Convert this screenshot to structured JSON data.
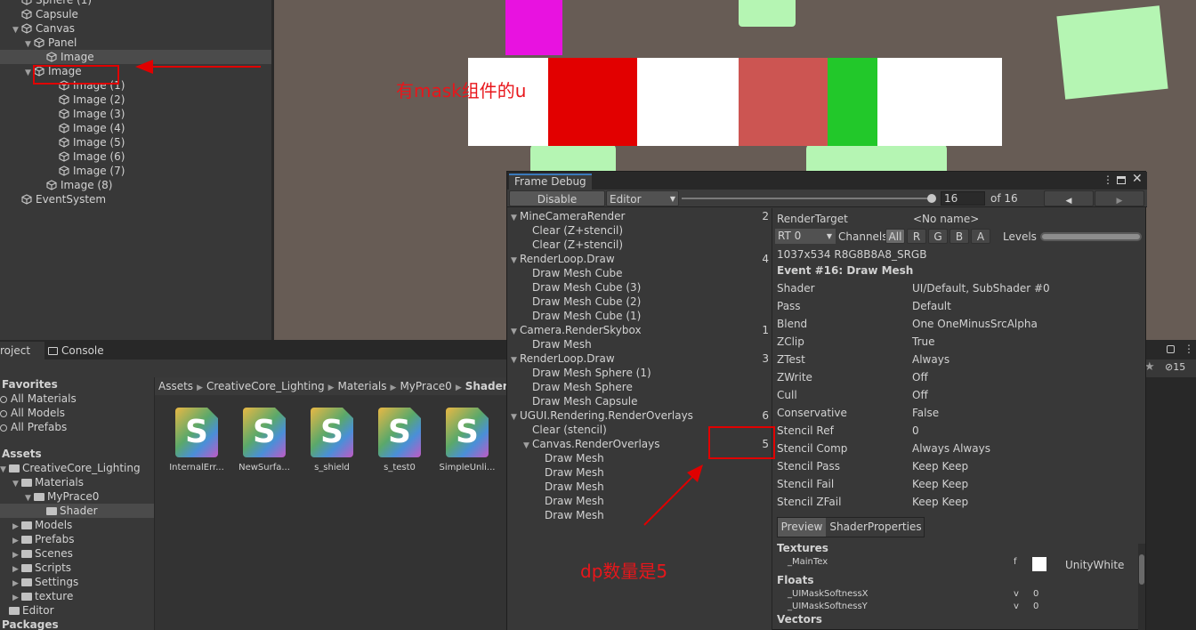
{
  "hierarchy": {
    "items": [
      {
        "label": "Sphere (1)",
        "indent": 1
      },
      {
        "label": "Capsule",
        "indent": 1
      },
      {
        "label": "Canvas",
        "indent": 1,
        "expanded": true
      },
      {
        "label": "Panel",
        "indent": 2,
        "expanded": true
      },
      {
        "label": "Image",
        "indent": 3,
        "selected": true
      },
      {
        "label": "Image",
        "indent": 2,
        "expanded": true,
        "highlighted": true
      },
      {
        "label": "Image (1)",
        "indent": 4
      },
      {
        "label": "Image (2)",
        "indent": 4
      },
      {
        "label": "Image (3)",
        "indent": 4
      },
      {
        "label": "Image (4)",
        "indent": 4
      },
      {
        "label": "Image (5)",
        "indent": 4
      },
      {
        "label": "Image (6)",
        "indent": 4
      },
      {
        "label": "Image (7)",
        "indent": 4
      },
      {
        "label": "Image (8)",
        "indent": 3
      },
      {
        "label": "EventSystem",
        "indent": 1
      }
    ]
  },
  "scene": {
    "annotation": "有mask组件的u"
  },
  "project": {
    "tab_project": "roject",
    "tab_console": "Console",
    "favorites_header": "Favorites",
    "favorites": [
      "All Materials",
      "All Models",
      "All Prefabs"
    ],
    "assets_header": "Assets",
    "tree": [
      {
        "label": "CreativeCore_Lighting",
        "indent": 0
      },
      {
        "label": "Materials",
        "indent": 1
      },
      {
        "label": "MyPrace0",
        "indent": 2
      },
      {
        "label": "Shader",
        "indent": 3,
        "selected": true
      },
      {
        "label": "Models",
        "indent": 1
      },
      {
        "label": "Prefabs",
        "indent": 1
      },
      {
        "label": "Scenes",
        "indent": 1
      },
      {
        "label": "Scripts",
        "indent": 1
      },
      {
        "label": "Settings",
        "indent": 1
      },
      {
        "label": "texture",
        "indent": 1
      },
      {
        "label": "Editor",
        "indent": 0
      }
    ],
    "packages_header": "Packages",
    "breadcrumb": [
      "Assets",
      "CreativeCore_Lighting",
      "Materials",
      "MyPrace0",
      "Shader"
    ],
    "assets": [
      "InternalErr...",
      "NewSurfa...",
      "s_shield",
      "s_test0",
      "SimpleUnli..."
    ],
    "asset_glyph": "S",
    "hidden_count": "15"
  },
  "frame_debug": {
    "title": "Frame Debug",
    "disable_label": "Disable",
    "editor_label": "Editor",
    "frame_value": "16",
    "of_label": "of 16",
    "events": [
      {
        "label": "MineCameraRender",
        "indent": 0,
        "count": "2"
      },
      {
        "label": "Clear (Z+stencil)",
        "indent": 1
      },
      {
        "label": "Clear (Z+stencil)",
        "indent": 1
      },
      {
        "label": "RenderLoop.Draw",
        "indent": 0,
        "count": "4"
      },
      {
        "label": "Draw Mesh Cube",
        "indent": 1
      },
      {
        "label": "Draw Mesh Cube (3)",
        "indent": 1
      },
      {
        "label": "Draw Mesh Cube (2)",
        "indent": 1
      },
      {
        "label": "Draw Mesh Cube (1)",
        "indent": 1
      },
      {
        "label": "Camera.RenderSkybox",
        "indent": 0,
        "count": "1"
      },
      {
        "label": "Draw Mesh",
        "indent": 1
      },
      {
        "label": "RenderLoop.Draw",
        "indent": 0,
        "count": "3"
      },
      {
        "label": "Draw Mesh Sphere (1)",
        "indent": 1
      },
      {
        "label": "Draw Mesh Sphere",
        "indent": 1
      },
      {
        "label": "Draw Mesh Capsule",
        "indent": 1
      },
      {
        "label": "UGUI.Rendering.RenderOverlays",
        "indent": 0,
        "count": "6"
      },
      {
        "label": "Clear (stencil)",
        "indent": 1
      },
      {
        "label": "Canvas.RenderOverlays",
        "indent": 1,
        "count": "5",
        "expanded": true
      },
      {
        "label": "Draw Mesh",
        "indent": 2
      },
      {
        "label": "Draw Mesh",
        "indent": 2
      },
      {
        "label": "Draw Mesh",
        "indent": 2
      },
      {
        "label": "Draw Mesh",
        "indent": 2
      },
      {
        "label": "Draw Mesh",
        "indent": 2
      }
    ],
    "render_target_label": "RenderTarget",
    "render_target_value": "<No name>",
    "rt_select": "RT 0",
    "channels_label": "Channels",
    "channels": [
      "All",
      "R",
      "G",
      "B",
      "A"
    ],
    "levels_label": "Levels",
    "format": "1037x534 R8G8B8A8_SRGB",
    "event_title": "Event #16: Draw Mesh",
    "props": [
      {
        "k": "Shader",
        "v": "UI/Default, SubShader #0"
      },
      {
        "k": "Pass",
        "v": "Default"
      },
      {
        "k": "Blend",
        "v": "One OneMinusSrcAlpha"
      },
      {
        "k": "ZClip",
        "v": "True"
      },
      {
        "k": "ZTest",
        "v": "Always"
      },
      {
        "k": "ZWrite",
        "v": "Off"
      },
      {
        "k": "Cull",
        "v": "Off"
      },
      {
        "k": "Conservative",
        "v": "False"
      },
      {
        "k": "Stencil Ref",
        "v": "0"
      },
      {
        "k": "Stencil Comp",
        "v": "Always Always"
      },
      {
        "k": "Stencil Pass",
        "v": "Keep Keep"
      },
      {
        "k": "Stencil Fail",
        "v": "Keep Keep"
      },
      {
        "k": "Stencil ZFail",
        "v": "Keep Keep"
      }
    ],
    "tab_preview": "Preview",
    "tab_shader_props": "ShaderProperties",
    "textures_header": "Textures",
    "main_tex": {
      "name": "_MainTex",
      "stage": "f",
      "value": "UnityWhite"
    },
    "floats_header": "Floats",
    "floats": [
      {
        "name": "_UIMaskSoftnessX",
        "stage": "v",
        "value": "0"
      },
      {
        "name": "_UIMaskSoftnessY",
        "stage": "v",
        "value": "0"
      }
    ],
    "vectors_header": "Vectors"
  },
  "annotation_dp": "dp数量是5",
  "colors": {
    "annotation_red": "#e00000",
    "scene_bg": "#675c55",
    "green_cube": "#b5f5b3",
    "red_block": "#e20000",
    "muted_red_block": "#cc5552",
    "green_block": "#22c82a",
    "magenta": "#e812e0"
  }
}
